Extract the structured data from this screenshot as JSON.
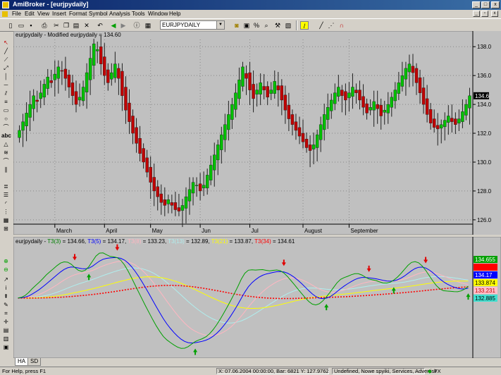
{
  "window": {
    "title": "AmiBroker - [eurjpydaily]"
  },
  "menu": [
    "File",
    "Edit",
    "View",
    "Insert",
    "Format",
    "Symbol",
    "Analysis",
    "Tools",
    "Window",
    "Help"
  ],
  "toolbar": {
    "symbol": "EURJPYDAILY"
  },
  "price_pane": {
    "title": "eurjpydaily - Modified eurjpydaily = 134.60",
    "last_price_label": "134.6",
    "bull_color": "#00c000",
    "bear_color": "#c00000",
    "chart_data": {
      "type": "candlestick",
      "x_ticks": [
        "March",
        "April",
        "May",
        "Jun",
        "Jul",
        "August",
        "September"
      ],
      "y_ticks": [
        126.0,
        128.0,
        130.0,
        132.0,
        134.0,
        136.0,
        138.0
      ],
      "ylim": [
        125.7,
        138.5
      ],
      "close": [
        132.2,
        132.8,
        133.4,
        134.0,
        134.6,
        134.2,
        134.8,
        135.4,
        135.9,
        135.5,
        136.1,
        136.6,
        136.3,
        135.8,
        135.2,
        134.6,
        134.0,
        134.5,
        135.2,
        136.2,
        137.2,
        138.2,
        137.8,
        136.8,
        136.0,
        135.5,
        136.2,
        136.8,
        135.8,
        134.6,
        133.6,
        132.8,
        132.0,
        131.3,
        130.6,
        130.0,
        129.3,
        128.6,
        128.0,
        127.6,
        127.2,
        127.0,
        127.4,
        127.0,
        126.7,
        126.6,
        127.0,
        127.6,
        128.1,
        128.6,
        128.4,
        128.0,
        128.4,
        129.1,
        129.8,
        130.5,
        131.2,
        131.9,
        132.6,
        133.3,
        134.0,
        134.8,
        135.7,
        136.6,
        135.8,
        135.0,
        134.4,
        135.0,
        135.5,
        135.0,
        134.5,
        135.0,
        135.6,
        135.0,
        134.3,
        133.6,
        133.0,
        132.6,
        132.2,
        131.8,
        131.4,
        131.0,
        130.8,
        131.2,
        131.9,
        132.6,
        133.3,
        133.8,
        134.3,
        134.8,
        135.2,
        134.6,
        134.3,
        134.8,
        135.2,
        134.8,
        134.3,
        133.8,
        133.4,
        133.8,
        134.2,
        133.7,
        133.2,
        133.6,
        134.0,
        134.5,
        135.0,
        135.5,
        136.0,
        136.5,
        136.8,
        136.2,
        135.5,
        134.8,
        134.0,
        133.3,
        132.7,
        132.4,
        132.3,
        132.6,
        132.9,
        133.2,
        132.8,
        132.6,
        133.0,
        133.5,
        134.0,
        134.6
      ],
      "tick_index": [
        10,
        24,
        37,
        51,
        65,
        80,
        93
      ]
    }
  },
  "ind_pane": {
    "legend": [
      {
        "text": "eurjpydaily - ",
        "color": "#000000"
      },
      {
        "text": "T3(3)",
        "color": "#008000"
      },
      {
        "text": " = 134.66, ",
        "color": "#000000"
      },
      {
        "text": "T3(5)",
        "color": "#0000ff"
      },
      {
        "text": " = 134.17, ",
        "color": "#000000"
      },
      {
        "text": "T3(8)",
        "color": "#ffb6c1"
      },
      {
        "text": " = 133.23, ",
        "color": "#000000"
      },
      {
        "text": "T3(13)",
        "color": "#afeeee"
      },
      {
        "text": " = 132.89, ",
        "color": "#000000"
      },
      {
        "text": "T3(21)",
        "color": "#ffff00"
      },
      {
        "text": " = 133.87, ",
        "color": "#000000"
      },
      {
        "text": "T3(34)",
        "color": "#ff0000"
      },
      {
        "text": " = 134.61",
        "color": "#000000"
      }
    ],
    "value_boxes": [
      {
        "text": "134.655",
        "bg": "#00a000",
        "fg": "#ffffff"
      },
      {
        "text": "134.61",
        "bg": "#ff0000",
        "fg": "#ff0000"
      },
      {
        "text": "134.17",
        "bg": "#0000ff",
        "fg": "#ffffff"
      },
      {
        "text": "133.874",
        "bg": "#ffff00",
        "fg": "#000000"
      },
      {
        "text": "133.231",
        "bg": "#ffc0cb",
        "fg": "#c00000"
      },
      {
        "text": "132.885",
        "bg": "#40e0d0",
        "fg": "#000000"
      }
    ],
    "series_colors": {
      "t3": "#00a000",
      "t5": "#0000ff",
      "t8": "#ffb6c1",
      "t13": "#afeeee",
      "t21": "#ffff00",
      "t34": "#ff0000"
    }
  },
  "tabs": [
    "HA",
    "SD"
  ],
  "status": {
    "help": "For Help, press F1",
    "coords": "X: 07.06.2004 00:00:00, Bar: 6821   Y: 127.9762",
    "db": "Undefined, Nowe spyiki, Services, Advertisir",
    "fx": "FX"
  }
}
